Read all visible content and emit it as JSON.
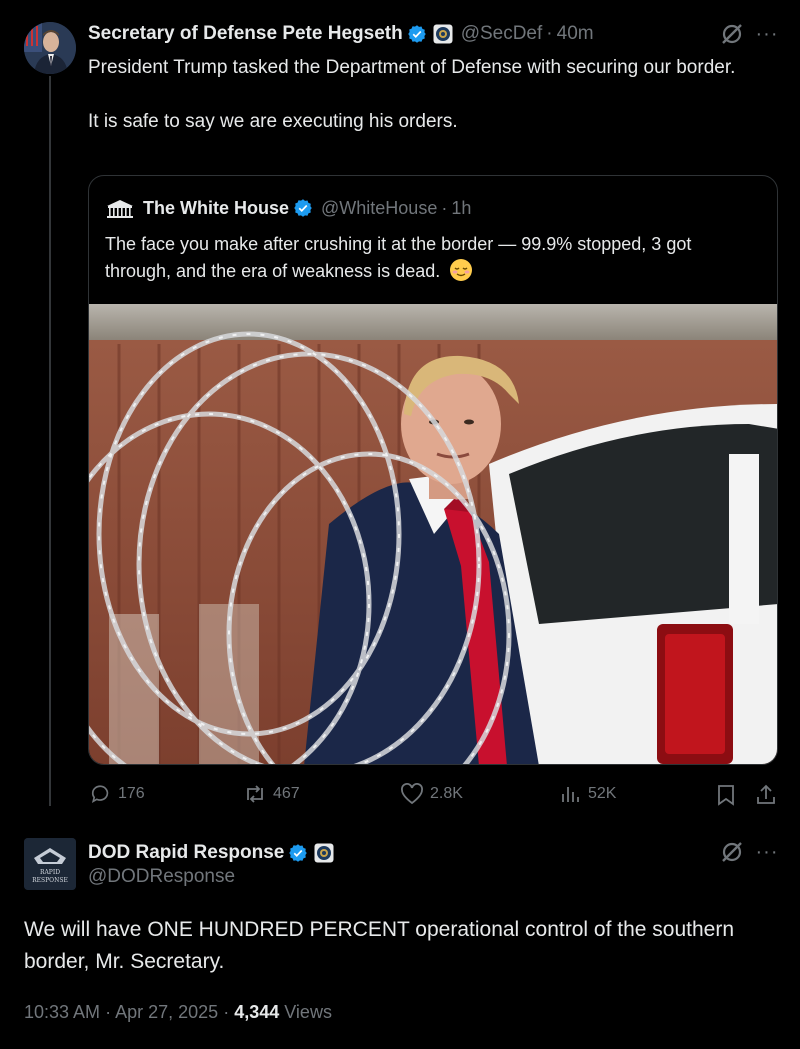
{
  "post": {
    "author_name": "Secretary of Defense Pete Hegseth",
    "handle": "@SecDef",
    "time": "40m",
    "text": "President Trump tasked the Department of Defense with securing our border.\n\nIt is safe to say we are executing his orders.",
    "quoted": {
      "author_name": "The White House",
      "handle": "@WhiteHouse",
      "time": "1h",
      "text": "The face you make after crushing it at the border — 99.9% stopped, 3 got through, and the era of weakness is dead."
    },
    "stats": {
      "replies": "176",
      "reposts": "467",
      "likes": "2.8K",
      "views": "52K"
    }
  },
  "reply": {
    "author_name": "DOD Rapid Response",
    "handle": "@DODResponse",
    "avatar_text": [
      "RAPID",
      "RESPONSE"
    ],
    "text": "We will have ONE HUNDRED PERCENT operational control of the southern border, Mr. Secretary.",
    "time": "10:33 AM",
    "date": "Apr 27, 2025",
    "views_count": "4,344",
    "views_label": "Views"
  },
  "colors": {
    "background": "#000000",
    "text": "#e7e9ea",
    "muted": "#71767b",
    "verified": "#1d9bf0",
    "tie": "#c8102e"
  },
  "icons": [
    "verified-badge-icon",
    "affiliation-badge-icon",
    "grok-icon",
    "more-icon",
    "reply-icon",
    "repost-icon",
    "like-icon",
    "views-icon",
    "bookmark-icon",
    "share-icon"
  ]
}
